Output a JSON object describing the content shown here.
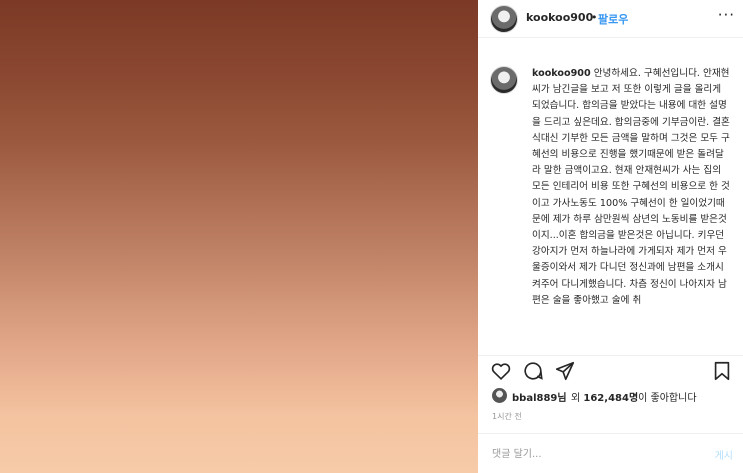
{
  "post": {
    "username": "kookoo900",
    "separator": "•",
    "follow_label": "팔로우",
    "more_label": "···",
    "caption_username": "kookoo900",
    "caption_text": "안녕하세요. 구혜선입니다. 안재현씨가 남긴글을 보고 저 또한 이렇게 글을 올리게 되었습니다. 합의금을 받았다는 내용에 대한 설명을 드리고 싶은데요. 합의금중에 기부금이란. 결혼식대신 기부한 모든 금액을 말하며 그것은 모두 구혜선의 비용으로 진행을 했기때문에 받은 돌려달라 말한 금액이고요. 현재 안재현씨가 사는 집의 모든 인테리어 비용 또한 구혜선의 비용으로 한 것이고 가사노동도 100% 구혜선이 한 일이었기때문에 제가 하루 삼만원씩 삼년의 노동비를 받은것이지...이혼 합의금을 받은것은 아닙니다. 키우던 강아지가 먼저 하늘나라에 가게되자 제가 먼저 우울증이와서 제가 다니던 정신과에 남편을 소개시켜주어 다니게했습니다. 차츰 정신이 나아지자 남편은 술을 좋아했고 술에 취",
    "likes": {
      "liker": "bbal889님",
      "middle": " 외 ",
      "count": "162,484명",
      "suffix": "이 좋아합니다"
    },
    "time": "1시간 전",
    "comment_placeholder": "댓글 달기...",
    "post_label": "게시"
  },
  "icons": {
    "heart": "heart-icon",
    "comment": "comment-icon",
    "share": "share-icon",
    "bookmark": "bookmark-icon"
  }
}
